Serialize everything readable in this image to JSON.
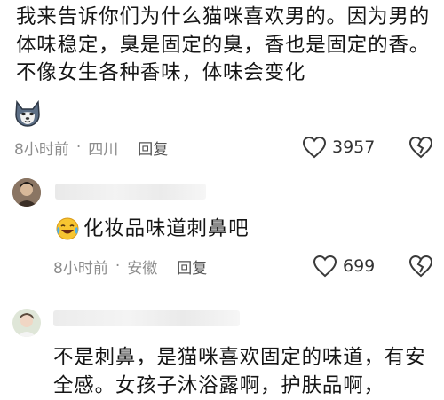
{
  "comments": [
    {
      "text": "我来告诉你们为什么猫咪喜欢男的。因为男的体味稳定，臭是固定的臭，香也是固定的香。不像女生各种香味，体味会变化",
      "time": "8小时前",
      "location": "四川",
      "reply_label": "回复",
      "likes": "3957",
      "emoji": "doge-emoji"
    },
    {
      "text": "化妆品味道刺鼻吧",
      "time": "8小时前",
      "location": "安徽",
      "reply_label": "回复",
      "likes": "699",
      "emoji": "laughing-crying-emoji"
    },
    {
      "text": "不是刺鼻，是猫咪喜欢固定的味道，有安全感。女孩子沐浴露啊，护肤品啊，"
    }
  ],
  "icons": {
    "like": "heart-outline-icon",
    "dislike": "broken-heart-icon"
  },
  "colors": {
    "text": "#161616",
    "meta": "#8d8d8d",
    "icon": "#3a3a3a"
  }
}
